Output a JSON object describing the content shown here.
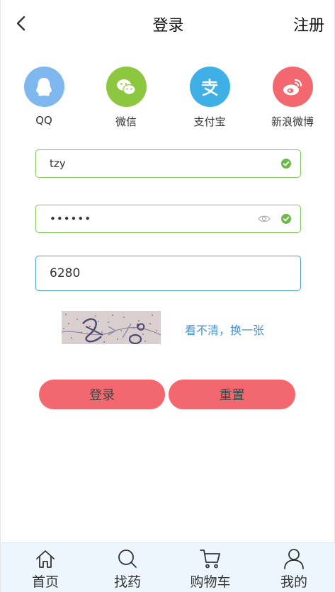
{
  "header": {
    "title": "登录",
    "register_label": "注册"
  },
  "social": {
    "items": [
      {
        "label": "QQ",
        "icon": "qq-icon",
        "color": "#7eb8ef"
      },
      {
        "label": "微信",
        "icon": "wechat-icon",
        "color": "#8dc63f"
      },
      {
        "label": "支付宝",
        "icon": "alipay-icon",
        "color": "#3fb0e6"
      },
      {
        "label": "新浪微博",
        "icon": "weibo-icon",
        "color": "#f2686e"
      }
    ]
  },
  "form": {
    "username_value": "tzy",
    "password_value": "••••••",
    "captcha_value": "6280",
    "refresh_captcha_label": "看不清，换一张"
  },
  "buttons": {
    "login_label": "登录",
    "reset_label": "重置"
  },
  "tabbar": {
    "items": [
      {
        "label": "首页",
        "icon": "home-icon"
      },
      {
        "label": "找药",
        "icon": "search-icon"
      },
      {
        "label": "购物车",
        "icon": "cart-icon"
      },
      {
        "label": "我的",
        "icon": "user-icon"
      }
    ]
  },
  "colors": {
    "accent_button": "#f2686e",
    "valid_border": "#7ec75b",
    "focus_border": "#4a9ad6",
    "link": "#4a90cf",
    "tabbar_bg": "#eef6fd"
  }
}
